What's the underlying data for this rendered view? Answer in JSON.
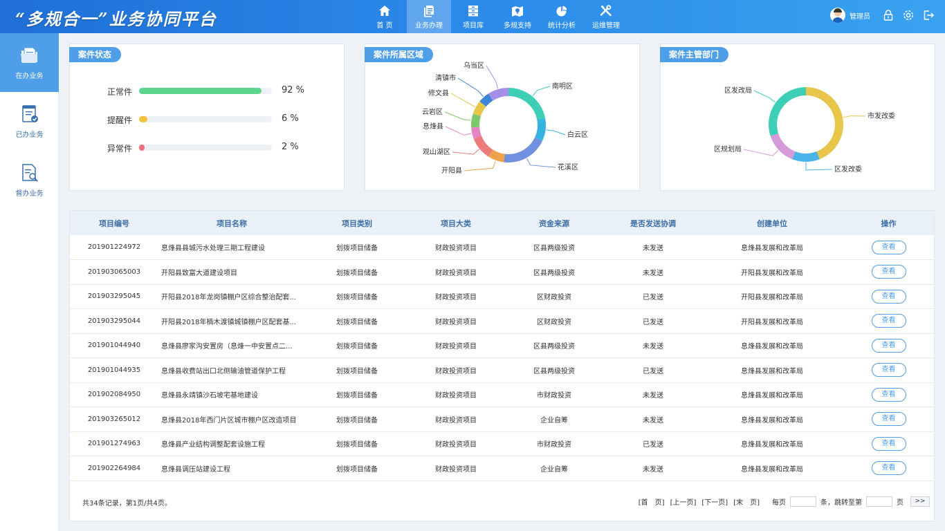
{
  "header": {
    "title": "“多规合一”业务协同平台",
    "nav": [
      {
        "label": "首 页",
        "icon": "home-icon"
      },
      {
        "label": "业务办理",
        "icon": "document-icon",
        "active": true
      },
      {
        "label": "项目库",
        "icon": "database-icon"
      },
      {
        "label": "多规支持",
        "icon": "map-icon"
      },
      {
        "label": "统计分析",
        "icon": "pie-chart-icon"
      },
      {
        "label": "运维管理",
        "icon": "tools-icon"
      }
    ],
    "user": {
      "name": "管理员"
    }
  },
  "sidebar": {
    "items": [
      {
        "label": "在办业务",
        "icon": "folder-icon",
        "active": true
      },
      {
        "label": "已办业务",
        "icon": "checklist-icon"
      },
      {
        "label": "督办业务",
        "icon": "search-document-icon"
      }
    ]
  },
  "status_card": {
    "title": "案件状态",
    "items": [
      {
        "name": "正常件",
        "value": 92,
        "pct_text": "92 %",
        "color": "#5bd68d"
      },
      {
        "name": "提醒件",
        "value": 6,
        "pct_text": "6 %",
        "color": "#f5c13b"
      },
      {
        "name": "异常件",
        "value": 2,
        "pct_text": "2 %",
        "color": "#f06e7b"
      }
    ]
  },
  "region_card": {
    "title": "案件所属区域",
    "segments": [
      {
        "name": "南明区",
        "value": 22,
        "color": "#3dcfb6"
      },
      {
        "name": "白云区",
        "value": 10,
        "color": "#35b4e0"
      },
      {
        "name": "花溪区",
        "value": 20,
        "color": "#7290e0"
      },
      {
        "name": "开阳县",
        "value": 7,
        "color": "#f0a24a"
      },
      {
        "name": "观山湖区",
        "value": 10,
        "color": "#ee7b7b"
      },
      {
        "name": "息烽县",
        "value": 5,
        "color": "#e684c4"
      },
      {
        "name": "云岩区",
        "value": 6,
        "color": "#7cc86a"
      },
      {
        "name": "修文县",
        "value": 6,
        "color": "#e8c64a"
      },
      {
        "name": "清镇市",
        "value": 5,
        "color": "#3f86d8"
      },
      {
        "name": "乌当区",
        "value": 9,
        "color": "#a48ee8"
      }
    ]
  },
  "dept_card": {
    "title": "案件主管部门",
    "segments": [
      {
        "name": "市发改委",
        "value": 44,
        "color": "#e8c64a"
      },
      {
        "name": "区发改委",
        "value": 12,
        "color": "#4ab3e8"
      },
      {
        "name": "区规划局",
        "value": 14,
        "color": "#d69ad8"
      },
      {
        "name": "区发改局",
        "value": 30,
        "color": "#3dcfb6"
      }
    ]
  },
  "table": {
    "headers": [
      "项目编号",
      "项目名称",
      "项目类别",
      "项目大类",
      "资金来源",
      "是否发送协调",
      "创建单位",
      "操作"
    ],
    "rows": [
      [
        "201901224972",
        "息烽县县城污水处理三期工程建设",
        "划拨项目储备",
        "财政投资项目",
        "区县两级投资",
        "未发送",
        "息烽县发展和改革局",
        "查看"
      ],
      [
        "201903065003",
        "开阳县致富大道建设项目",
        "划拨项目储备",
        "财政投资项目",
        "区县两级投资",
        "未发送",
        "开阳县发展和改革局",
        "查看"
      ],
      [
        "201903295045",
        "开阳县2018年龙岗镇棚户区综合整治配套...",
        "划拨项目储备",
        "财政投资项目",
        "区财政投资",
        "已发送",
        "开阳县发展和改革局",
        "查看"
      ],
      [
        "201903295044",
        "开阳县2018年楠木渡镇城镇棚户区配套基...",
        "划拨项目储备",
        "财政投资项目",
        "区财政投资",
        "已发送",
        "开阳县发展和改革局",
        "查看"
      ],
      [
        "201901044940",
        "息烽县廖家沟安置房（息烽一中安置点二...",
        "划拨项目储备",
        "财政投资项目",
        "区县两级投资",
        "未发送",
        "息烽县发展和改革局",
        "查看"
      ],
      [
        "201901044935",
        "息烽县收费站出口北侧输油管道保护工程",
        "划拨项目储备",
        "财政投资项目",
        "区县两级投资",
        "已发送",
        "息烽县发展和改革局",
        "查看"
      ],
      [
        "201902084950",
        "息烽县永靖镇沙石坡宅基地建设",
        "划拨项目储备",
        "财政投资项目",
        "市财政投资",
        "未发送",
        "息烽县发展和改革局",
        "查看"
      ],
      [
        "201903265012",
        "息烽县2018年西门片区城市棚户区改造项目",
        "划拨项目储备",
        "财政投资项目",
        "企业自筹",
        "未发送",
        "息烽县发展和改革局",
        "查看"
      ],
      [
        "201901274963",
        "息烽县产业结构调整配套设施工程",
        "划拨项目储备",
        "财政投资项目",
        "市财政投资",
        "已发送",
        "息烽县发展和改革局",
        "查看"
      ],
      [
        "201902264984",
        "息烽县调压站建设工程",
        "划拨项目储备",
        "财政投资项目",
        "企业自筹",
        "未发送",
        "息烽县发展和改革局",
        "查看"
      ]
    ],
    "footer_info": "共34条记录，第1页/共4页。",
    "pager": {
      "first": "[首　页]",
      "prev": "[上一页]",
      "next": "[下一页]",
      "last": "[末　页]",
      "per_page_label": "每页",
      "jump_label": "条，跳转至第",
      "page_suffix": "页",
      "go": ">>"
    }
  }
}
